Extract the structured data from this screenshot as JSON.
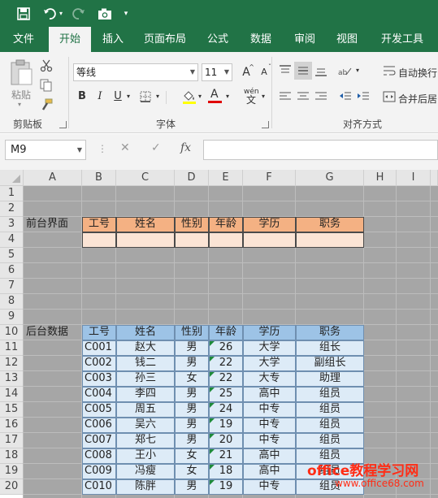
{
  "qat": {
    "save_icon": "save-icon",
    "undo_icon": "undo-icon",
    "redo_icon": "redo-icon",
    "camera_icon": "camera-icon",
    "customize_icon": "chevron-down-icon"
  },
  "tabs": [
    "文件",
    "开始",
    "插入",
    "页面布局",
    "公式",
    "数据",
    "审阅",
    "视图",
    "开发工具"
  ],
  "ribbon": {
    "paste_label": "粘贴",
    "clipboard_label": "剪贴板",
    "font_name": "等线",
    "font_size": "11",
    "font_group_label": "字体",
    "bold": "B",
    "italic": "I",
    "underline": "U",
    "increase_font": "A",
    "decrease_font": "A",
    "phonetic": "wén",
    "align_group_label": "对齐方式",
    "wrap_text": "自动换行",
    "merge_center": "合并后居"
  },
  "formula_bar": {
    "name_box": "M9",
    "fx": "fx",
    "formula": ""
  },
  "columns": [
    "A",
    "B",
    "C",
    "D",
    "E",
    "F",
    "G",
    "H",
    "I"
  ],
  "rows": [
    "1",
    "2",
    "3",
    "4",
    "5",
    "6",
    "7",
    "8",
    "9",
    "10",
    "11",
    "12",
    "13",
    "14",
    "15",
    "16",
    "17",
    "18",
    "19",
    "20"
  ],
  "front_section": {
    "label": "前台界面",
    "headers": [
      "工号",
      "姓名",
      "性别",
      "年龄",
      "学历",
      "职务"
    ]
  },
  "back_section": {
    "label": "后台数据",
    "headers": [
      "工号",
      "姓名",
      "性别",
      "年龄",
      "学历",
      "职务"
    ],
    "records": [
      [
        "C001",
        "赵大",
        "男",
        "26",
        "大学",
        "组长"
      ],
      [
        "C002",
        "钱二",
        "男",
        "22",
        "大学",
        "副组长"
      ],
      [
        "C003",
        "孙三",
        "女",
        "22",
        "大专",
        "助理"
      ],
      [
        "C004",
        "李四",
        "男",
        "25",
        "高中",
        "组员"
      ],
      [
        "C005",
        "周五",
        "男",
        "24",
        "中专",
        "组员"
      ],
      [
        "C006",
        "吴六",
        "男",
        "19",
        "中专",
        "组员"
      ],
      [
        "C007",
        "郑七",
        "男",
        "20",
        "中专",
        "组员"
      ],
      [
        "C008",
        "王小",
        "女",
        "21",
        "高中",
        "组员"
      ],
      [
        "C009",
        "冯瘦",
        "女",
        "18",
        "高中",
        "组员"
      ],
      [
        "C010",
        "陈胖",
        "男",
        "19",
        "中专",
        "组员"
      ]
    ]
  },
  "colors": {
    "excel_green": "#217346",
    "front_header": "#f4b183",
    "front_input": "#fbe4d5",
    "back_header": "#9dc3e6",
    "back_data": "#ddebf7",
    "sheet_gray": "#a6a6a6"
  },
  "watermark": {
    "line1": "office教程学习网",
    "line2": "www.office68.com"
  }
}
